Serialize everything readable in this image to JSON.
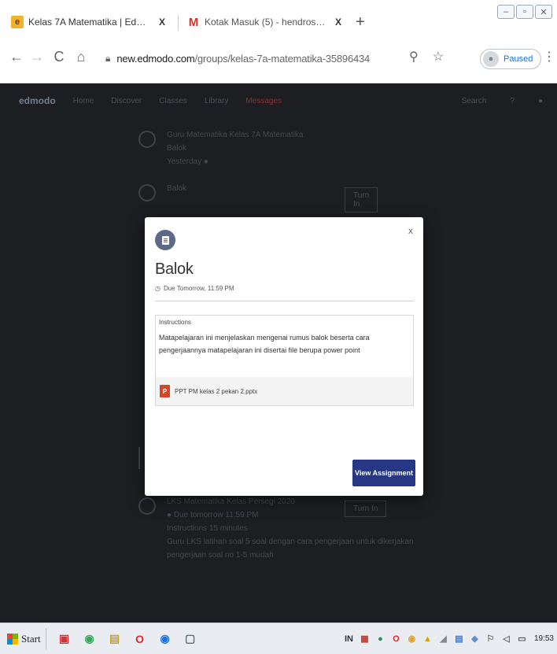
{
  "tabs": [
    {
      "title": "Kelas 7A Matematika | Edmodo",
      "favicon": "edmodo-icon",
      "close": "X",
      "active": true
    },
    {
      "title": "Kotak Masuk (5) - hendrostudent",
      "favicon": "gmail-icon",
      "close": "X",
      "active": false
    }
  ],
  "new_tab": "+",
  "window_controls": [
    "–",
    "▫",
    "✕"
  ],
  "nav": {
    "back": "←",
    "forward": "→",
    "reload": "C",
    "home": "⌂"
  },
  "omnibox": {
    "host": "new.edmodo.com",
    "path": "/groups/kelas-7a-matematika-35896434"
  },
  "profile": {
    "label": "Paused"
  },
  "background_page": {
    "logo": "edmodo",
    "header_items": [
      "Home",
      "Discover",
      "Classes",
      "Library"
    ],
    "header_alert": "Messages",
    "header_right": [
      "Search",
      "?",
      "●"
    ],
    "feed": [
      {
        "lines": [
          "Guru Matematika Kelas 7A Matematika",
          "Balok",
          "Yesterday ●"
        ]
      },
      {
        "lines": [
          "Balok",
          ""
        ],
        "button": "Turn In"
      },
      {
        "lines": [
          "LKS Matematika Kelas Persegi 2020",
          "● Due tomorrow 11:59 PM",
          "",
          "Instructions 15 minutes",
          "Guru LKS latihan soal 5 soal dengan cara pengerjaan untuk dikerjakan",
          "pengerjaan soal no 1-5 mudah"
        ],
        "button": "Turn In"
      }
    ]
  },
  "modal": {
    "close": "x",
    "title": "Balok",
    "due": "Due Tomorrow, 11:59 PM",
    "instructions_label": "Instructions",
    "instructions": "Matapelajaran ini menjelaskan mengenai rumus balok beserta cara pengerjaannya matapelajaran ini disertai file berupa power point",
    "attachment": "PPT PM kelas 2 pekan 2.pptx",
    "cta": "View Assignment",
    "colors": {
      "cta": "#283784",
      "icon": "#5b6a86",
      "ppt": "#d24726"
    }
  },
  "taskbar": {
    "start": "Start",
    "apps": [
      {
        "icon": "file-icon",
        "glyph": "▣",
        "color": "#d13438"
      },
      {
        "icon": "chrome-icon",
        "glyph": "◉",
        "color": "#34a853"
      },
      {
        "icon": "folder-icon",
        "glyph": "▤",
        "color": "#c9a227"
      },
      {
        "icon": "opera-icon",
        "glyph": "O",
        "color": "#e0262b"
      },
      {
        "icon": "chrome-active-icon",
        "glyph": "◉",
        "color": "#1a73e8"
      },
      {
        "icon": "window-icon",
        "glyph": "▢",
        "color": "#5a6a7a"
      }
    ],
    "tray": [
      {
        "icon": "input-language-icon",
        "glyph": "IN",
        "color": "#333"
      },
      {
        "icon": "tray-app-icon",
        "glyph": "▦",
        "color": "#c0392b"
      },
      {
        "icon": "tray-green-icon",
        "glyph": "●",
        "color": "#2e8b57"
      },
      {
        "icon": "tray-opera-icon",
        "glyph": "O",
        "color": "#e0262b"
      },
      {
        "icon": "tray-chrome-icon",
        "glyph": "◉",
        "color": "#e2a12a"
      },
      {
        "icon": "tray-drive-icon",
        "glyph": "▲",
        "color": "#d9a300"
      },
      {
        "icon": "tray-signal-icon",
        "glyph": "◢",
        "color": "#888"
      },
      {
        "icon": "tray-doc-icon",
        "glyph": "▤",
        "color": "#3a7bd5"
      },
      {
        "icon": "tray-shield-icon",
        "glyph": "◆",
        "color": "#5c8fd6"
      },
      {
        "icon": "tray-flag-icon",
        "glyph": "⚐",
        "color": "#666"
      },
      {
        "icon": "volume-icon",
        "glyph": "◁",
        "color": "#666"
      },
      {
        "icon": "battery-icon",
        "glyph": "▭",
        "color": "#555"
      }
    ],
    "time": "19:53"
  }
}
